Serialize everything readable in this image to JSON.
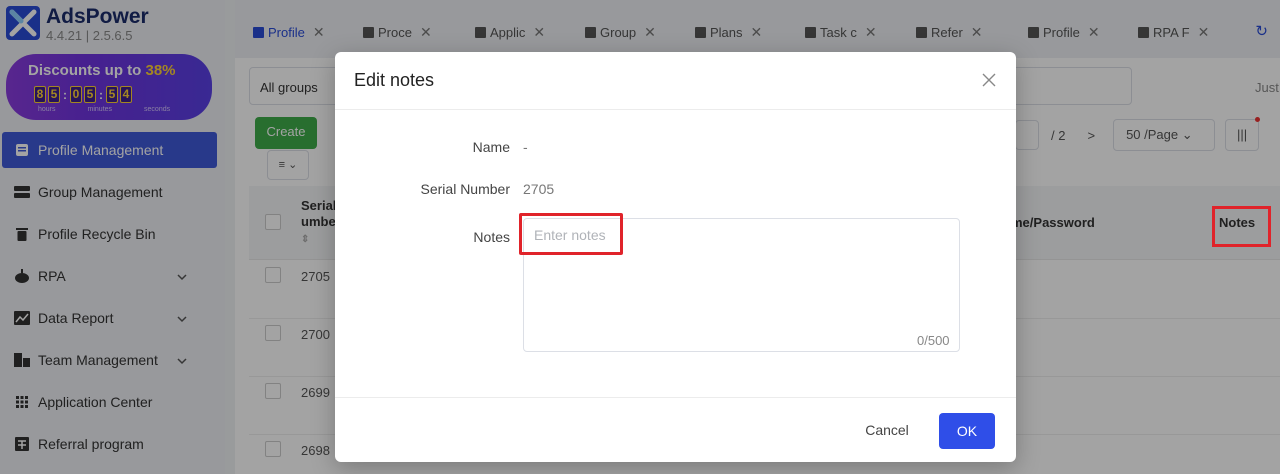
{
  "app": {
    "name": "AdsPower",
    "version": "4.4.21  |  2.5.6.5"
  },
  "promo": {
    "title_prefix": "Discounts up to ",
    "title_pct": "38%",
    "timer_digits": [
      "8",
      "5",
      "0",
      "5",
      "5",
      "4"
    ],
    "units": [
      "hours",
      "minutes",
      "seconds"
    ]
  },
  "sidebar": {
    "items": [
      {
        "label": "Profile Management",
        "icon": "profile-icon",
        "active": true
      },
      {
        "label": "Group Management",
        "icon": "group-icon"
      },
      {
        "label": "Profile Recycle Bin",
        "icon": "trash-icon"
      },
      {
        "label": "RPA",
        "icon": "robot-icon",
        "expandable": true
      },
      {
        "label": "Data Report",
        "icon": "chart-icon",
        "expandable": true
      },
      {
        "label": "Team Management",
        "icon": "team-icon",
        "expandable": true
      },
      {
        "label": "Application Center",
        "icon": "grid-icon"
      },
      {
        "label": "Referral program",
        "icon": "gift-icon"
      }
    ]
  },
  "tabs": [
    {
      "label": "Profile",
      "active": true
    },
    {
      "label": "Proce"
    },
    {
      "label": "Applic"
    },
    {
      "label": "Group"
    },
    {
      "label": "Plans"
    },
    {
      "label": "Task c"
    },
    {
      "label": "Refer"
    },
    {
      "label": "Profile"
    },
    {
      "label": "RPA F"
    }
  ],
  "toolbar": {
    "group_filter": "All groups",
    "just_text": "Just",
    "create_label": "Create",
    "page_total": "/  2",
    "page_next": ">",
    "page_size": "50 /Page",
    "columns_icon": "|||"
  },
  "table": {
    "headers": {
      "serial": "Serial\numbe",
      "user": "me/Password",
      "notes": "Notes"
    },
    "rows": [
      "2705",
      "2700",
      "2699",
      "2698"
    ]
  },
  "dialog": {
    "title": "Edit notes",
    "name_label": "Name",
    "name_value": "-",
    "serial_label": "Serial Number",
    "serial_value": "2705",
    "notes_label": "Notes",
    "notes_placeholder": "Enter notes",
    "notes_count": "0/500",
    "cancel_label": "Cancel",
    "ok_label": "OK"
  },
  "colors": {
    "brand": "#2a4bd7",
    "ok_button": "#2f4ee8",
    "create_button": "#3fad4a",
    "highlight": "#e0232a"
  }
}
